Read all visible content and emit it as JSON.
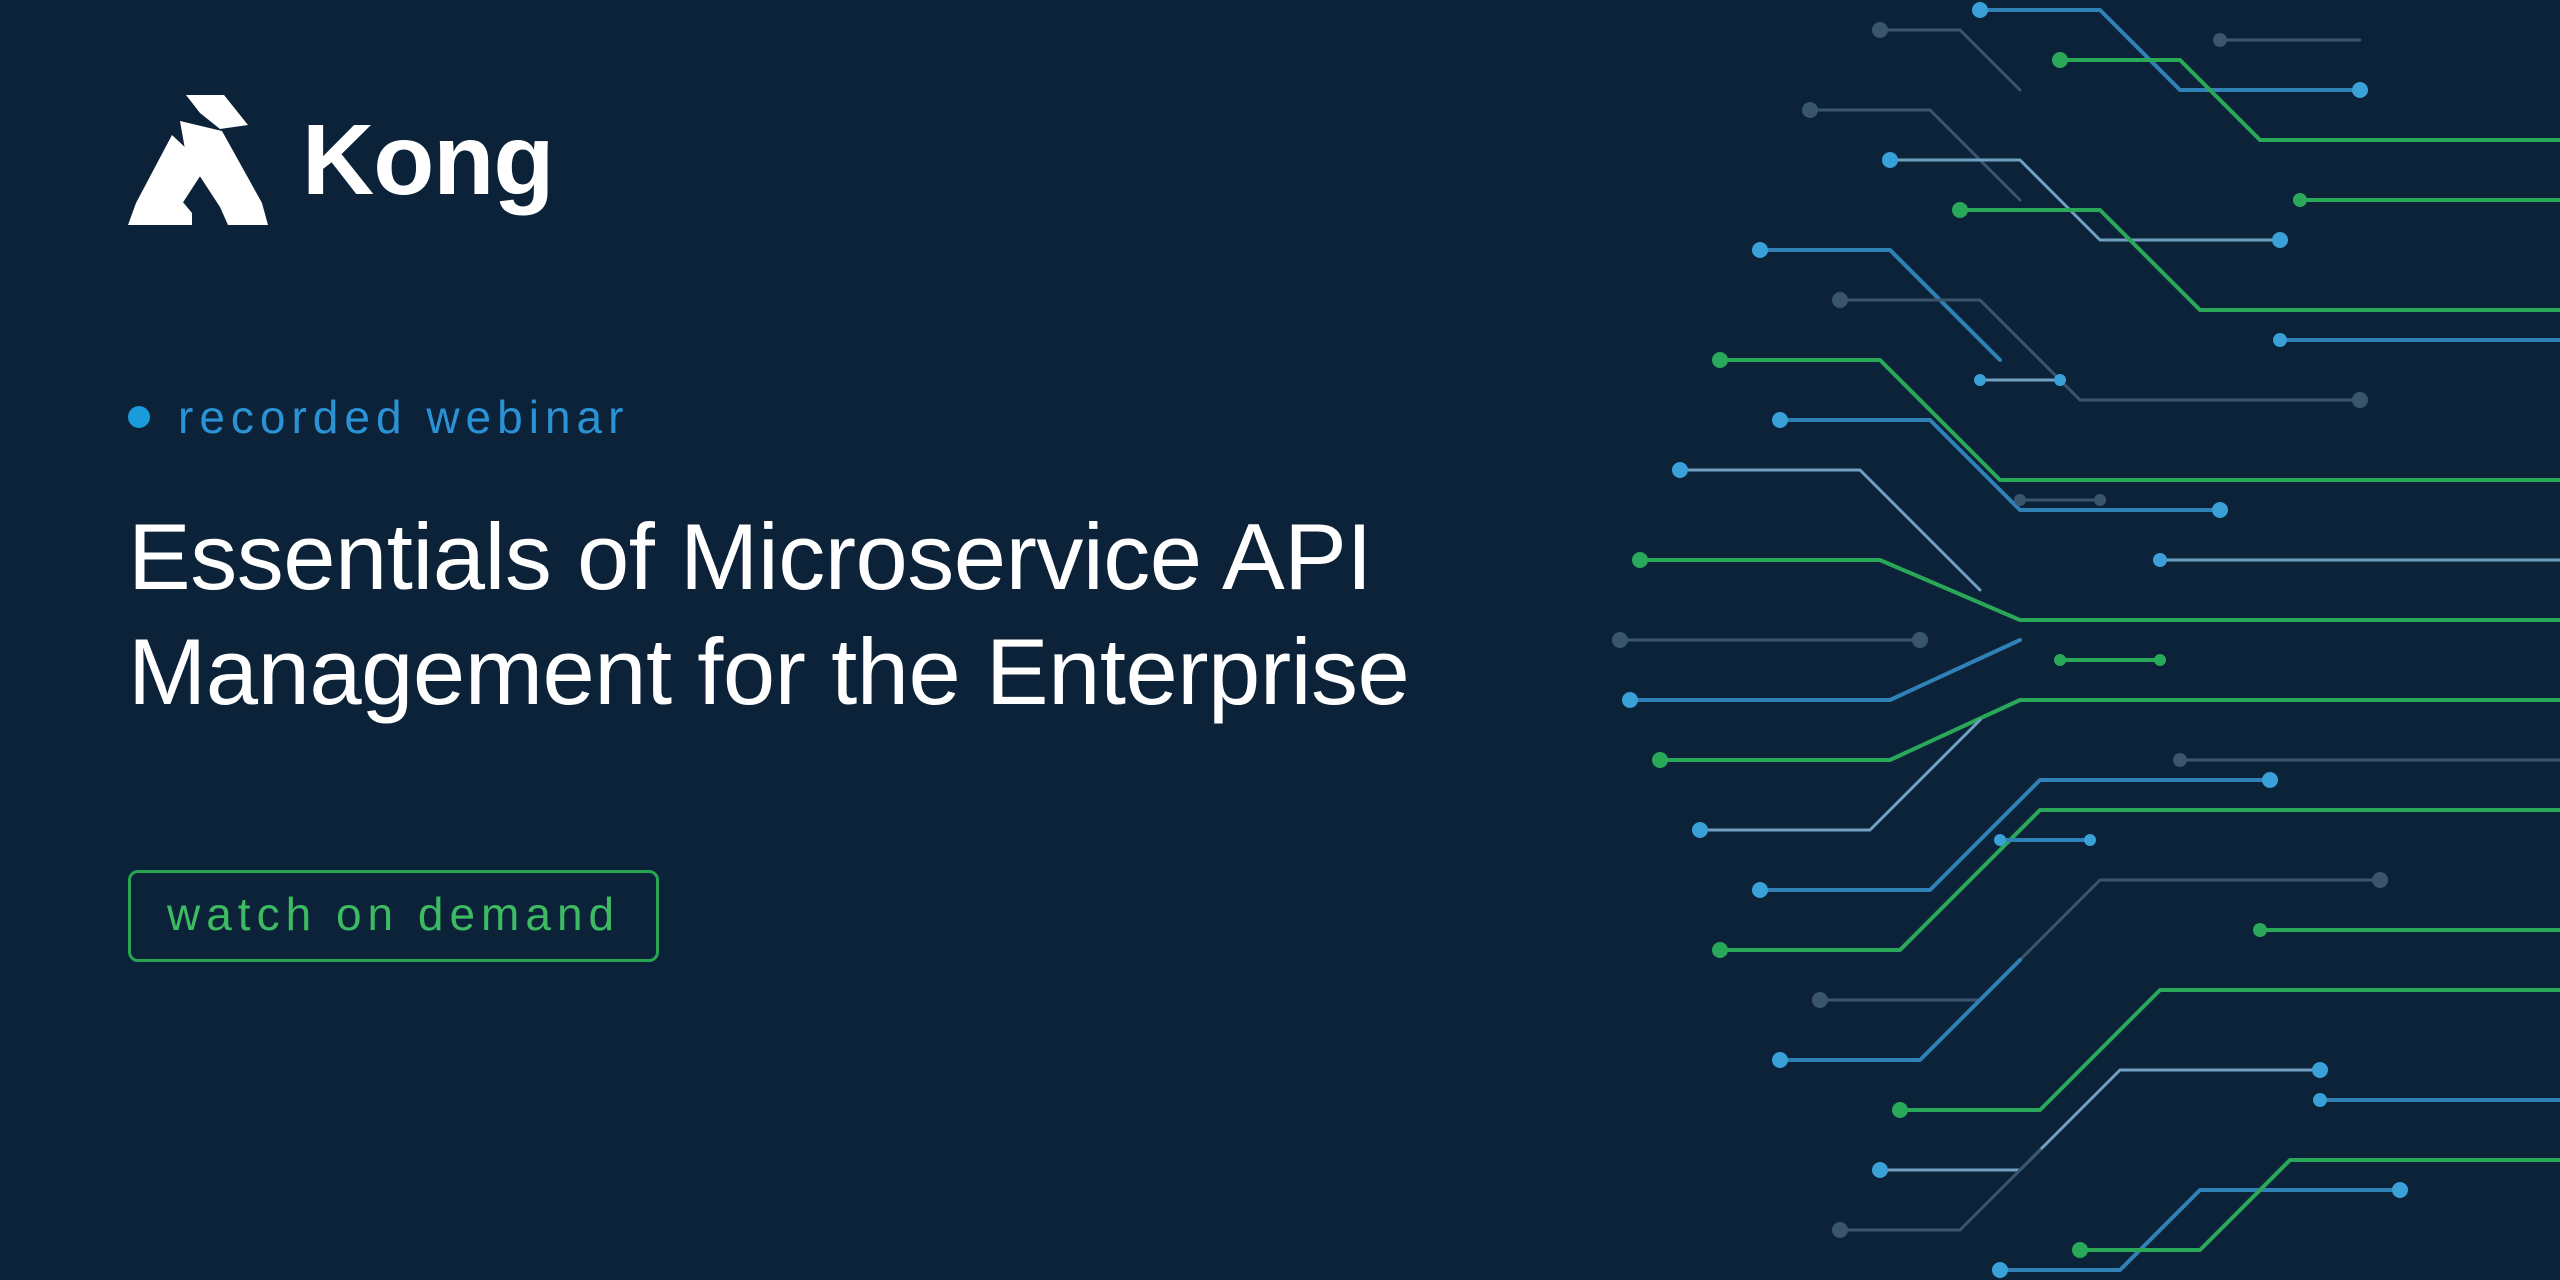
{
  "brand": {
    "name": "Kong"
  },
  "eyebrow": {
    "label": "recorded webinar"
  },
  "headline": {
    "text": "Essentials of Microservice API Management for the Enterprise"
  },
  "cta": {
    "label": "watch on demand"
  },
  "colors": {
    "background": "#0c2238",
    "accent_blue": "#1a9bdc",
    "accent_green": "#28a552",
    "text": "#ffffff"
  }
}
